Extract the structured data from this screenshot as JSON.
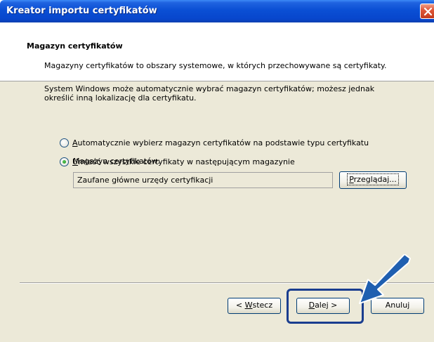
{
  "window": {
    "title": "Kreator importu certyfikatów"
  },
  "header": {
    "title": "Magazyn certyfikatów",
    "description": "Magazyny certyfikatów to obszary systemowe, w których przechowywane są certyfikaty."
  },
  "main": {
    "intro_line1": "System Windows może automatycznie wybrać magazyn certyfikatów; możesz jednak",
    "intro_line2": "określić inną lokalizację dla certyfikatu.",
    "options": [
      {
        "accel": "A",
        "rest": "utomatycznie wybierz magazyn certyfikatów na podstawie typu certyfikatu",
        "checked": false
      },
      {
        "accel": "U",
        "rest": "mieść wszystkie certyfikaty w następującym magazynie",
        "checked": true
      }
    ],
    "store_label": "Magazyn certyfikatów:",
    "store_value": "Zaufane główne urzędy certyfikacji",
    "browse_accel": "P",
    "browse_rest": "rzeglądaj..."
  },
  "footer": {
    "back_prefix": "< ",
    "back_accel": "W",
    "back_rest": "stecz",
    "next_accel": "D",
    "next_rest": "alej >",
    "cancel": "Anuluj"
  },
  "colors": {
    "titlebar": "#0a4fd4",
    "dialog_bg": "#ece9d8",
    "highlight": "#1a3d8f",
    "arrow": "#1f5fb0"
  }
}
